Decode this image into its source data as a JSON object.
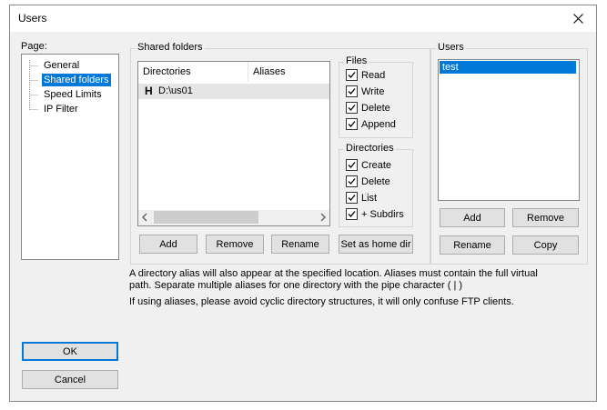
{
  "window": {
    "title": "Users"
  },
  "page_group": {
    "label": "Page:",
    "items": [
      "General",
      "Shared folders",
      "Speed Limits",
      "IP Filter"
    ]
  },
  "shared_folders": {
    "label": "Shared folders",
    "columns": [
      "Directories",
      "Aliases"
    ],
    "rows": [
      {
        "marker": "H",
        "directory": "D:\\us01",
        "alias": ""
      }
    ],
    "buttons": {
      "add": "Add",
      "remove": "Remove",
      "rename": "Rename",
      "set_home": "Set as home dir"
    }
  },
  "files": {
    "label": "Files",
    "options": [
      {
        "label": "Read",
        "checked": true
      },
      {
        "label": "Write",
        "checked": true
      },
      {
        "label": "Delete",
        "checked": true
      },
      {
        "label": "Append",
        "checked": true
      }
    ]
  },
  "directories": {
    "label": "Directories",
    "options": [
      {
        "label": "Create",
        "checked": true
      },
      {
        "label": "Delete",
        "checked": true
      },
      {
        "label": "List",
        "checked": true
      },
      {
        "label": "+ Subdirs",
        "checked": true
      }
    ]
  },
  "users": {
    "label": "Users",
    "list": [
      "test"
    ],
    "buttons": {
      "add": "Add",
      "remove": "Remove",
      "rename": "Rename",
      "copy": "Copy"
    }
  },
  "info": {
    "line1": "A directory alias will also appear at the specified location. Aliases must contain the full virtual",
    "line2": "path. Separate multiple aliases for one directory with the pipe character ( | )",
    "line3": "If using aliases, please avoid cyclic directory structures, it will only confuse FTP clients."
  },
  "footer": {
    "ok": "OK",
    "cancel": "Cancel"
  },
  "colors": {
    "selection": "#0078d7",
    "row_highlight": "#e5e5e5",
    "accent": "#0078d7"
  }
}
